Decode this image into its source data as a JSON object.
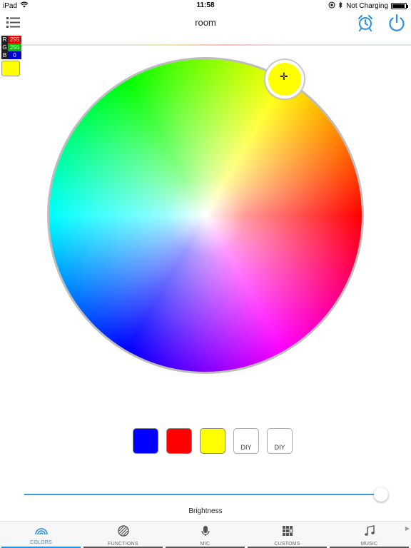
{
  "status": {
    "device": "iPad",
    "time": "11:58",
    "charging": "Not Charging",
    "battery_level": 0.95
  },
  "nav": {
    "title": "room"
  },
  "rgb": {
    "r_label": "R",
    "r": "255",
    "g_label": "G",
    "g": "255",
    "b_label": "B",
    "b": "0",
    "current_color": "#ffff00"
  },
  "presets": [
    {
      "color": "#0000ff",
      "label": ""
    },
    {
      "color": "#ff0000",
      "label": ""
    },
    {
      "color": "#ffff00",
      "label": ""
    },
    {
      "color": "",
      "label": "DIY"
    },
    {
      "color": "",
      "label": "DIY"
    }
  ],
  "brightness": {
    "label": "Brightness",
    "value": 0.98
  },
  "tabs": [
    {
      "label": "COLORS",
      "icon": "rainbow-icon",
      "active": true
    },
    {
      "label": "FUNCTIONS",
      "icon": "functions-icon",
      "active": false
    },
    {
      "label": "MIC",
      "icon": "microphone-icon",
      "active": false
    },
    {
      "label": "CUSTOMS",
      "icon": "grid-icon",
      "active": false
    },
    {
      "label": "MUSIC",
      "icon": "music-note-icon",
      "active": false
    }
  ],
  "colors": {
    "accent": "#2b8fe0",
    "selected": "#ffff00"
  }
}
